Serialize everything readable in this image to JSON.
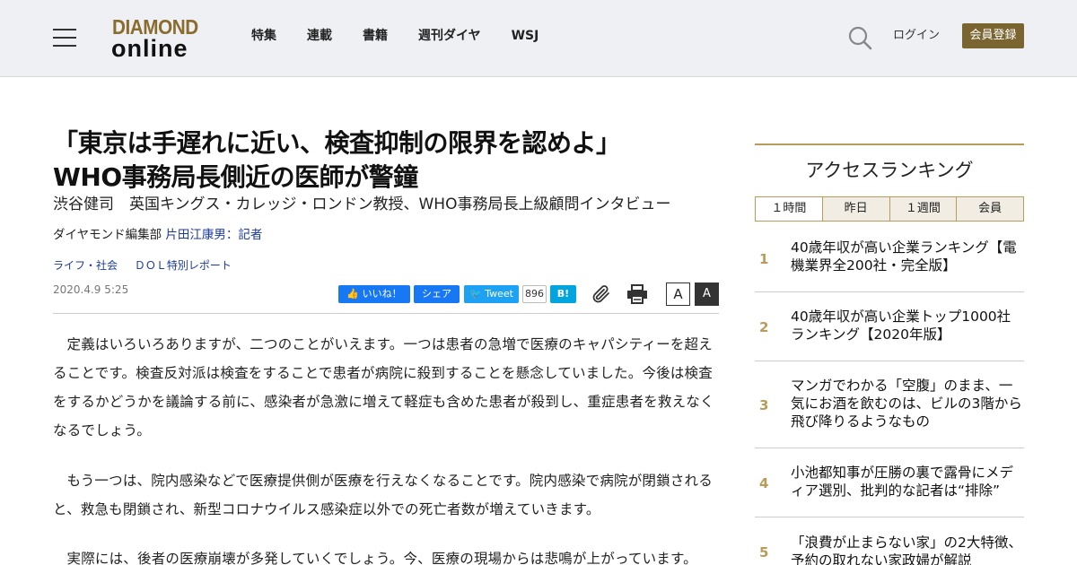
{
  "header": {
    "logo_top": "DIAMOND",
    "logo_bottom": "online",
    "nav": [
      "特集",
      "連載",
      "書籍",
      "週刊ダイヤ",
      "WSJ"
    ],
    "login": "ログイン",
    "register": "会員登録"
  },
  "article": {
    "title_line1": "「東京は手遅れに近い、検査抑制の限界を認めよ」",
    "title_line2": "WHO事務局長側近の医師が警鐘",
    "subtitle": "渋谷健司　英国キングス・カレッジ・ロンドン教授、WHO事務局長上級顧問インタビュー",
    "byline_prefix": "ダイヤモンド編集部",
    "byline_author": "片田江康男：記者",
    "tags": [
      "ライフ・社会",
      "ＤＯＬ特別レポート"
    ],
    "date": "2020.4.9 5:25",
    "share": {
      "facebook_like": "いいね！",
      "facebook_share": "シェア",
      "tweet": "Tweet",
      "hatena_count": "896",
      "hatena": "B!"
    },
    "font_small": "A",
    "font_large": "A",
    "paragraphs": [
      "定義はいろいろありますが、二つのことがいえます。一つは患者の急増で医療のキャパシティーを超えることです。検査反対派は検査をすることで患者が病院に殺到することを懸念していました。今後は検査をするかどうかを議論する前に、感染者が急激に増えて軽症も含めた患者が殺到し、重症患者を救えなくなるでしょう。",
      "もう一つは、院内感染などで医療提供側が医療を行えなくなることです。院内感染で病院が閉鎖されると、救急も閉鎖され、新型コロナウイルス感染症以外での死亡者数が増えていきます。",
      "実際には、後者の医療崩壊が多発していくでしょう。今、医療の現場からは悲鳴が上がっています。"
    ]
  },
  "ranking": {
    "title": "アクセスランキング",
    "tabs": [
      "１時間",
      "昨日",
      "１週間",
      "会員"
    ],
    "items": [
      {
        "rank": "1",
        "text": "40歳年収が高い企業ランキング【電機業界全200社・完全版】"
      },
      {
        "rank": "2",
        "text": "40歳年収が高い企業トップ1000社ランキング【2020年版】"
      },
      {
        "rank": "3",
        "text": "マンガでわかる「空腹」のまま、一気にお酒を飲むのは、ビルの3階から飛び降りるようなもの"
      },
      {
        "rank": "4",
        "text": "小池都知事が圧勝の裏で露骨にメディア選別、批判的な記者は“排除”"
      },
      {
        "rank": "5",
        "text": "「浪費が止まらない家」の2大特徴、予約の取れない家政婦が解説"
      }
    ]
  }
}
